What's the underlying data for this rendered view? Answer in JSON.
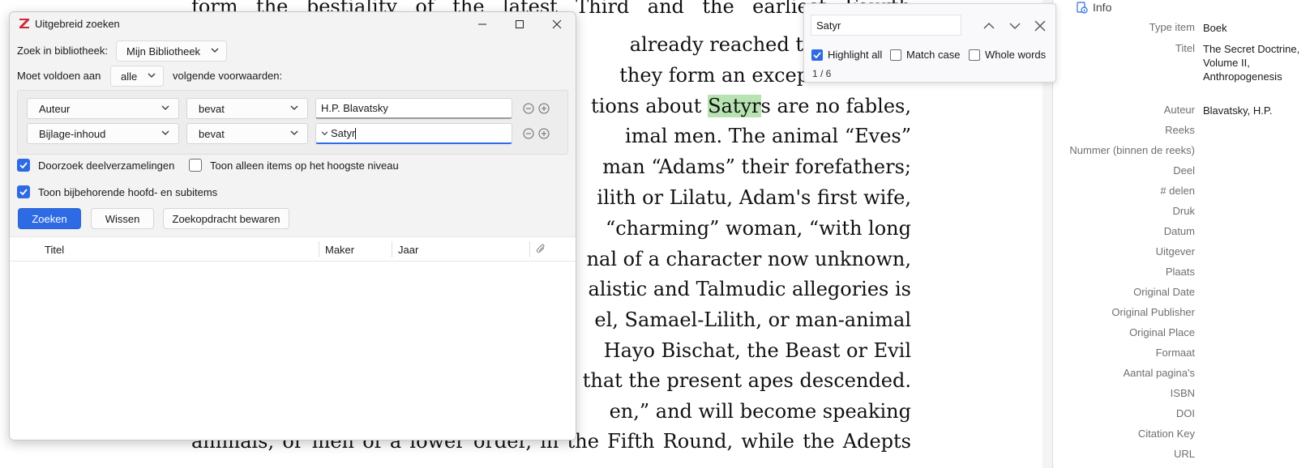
{
  "document": {
    "lines": [
      "form the bestiality of the latest Third and the earliest Fourth",
      "already reached the “human",
      "they form an exception to the",
      "tions about",
      "are no fables,",
      "imal men.  The animal “Eves”",
      "man “Adams” their forefathers;",
      "ilith or Lilatu, Adam's first wife,",
      "“charming” woman, “with long",
      "nal of a character now unknown,",
      "alistic and Talmudic allegories is",
      "el, Samael-Lilith, or man-animal",
      "Hayo Bischat, the Beast or Evil",
      "n that the present apes descended.",
      "en,” and will become speaking",
      "animals, or men of a lower order, in the Fifth Round, while the Adepts"
    ],
    "highlight": "Satyr",
    "highlight_suffix": "s"
  },
  "find_bar": {
    "query": "Satyr",
    "options": [
      {
        "label": "Highlight all",
        "checked": true
      },
      {
        "label": "Match case",
        "checked": false
      },
      {
        "label": "Whole words",
        "checked": false
      }
    ],
    "count": "1 / 6"
  },
  "info_pane": {
    "title": "Info",
    "rows": [
      {
        "label": "Type item",
        "value": "Boek"
      },
      {
        "label": "Titel",
        "value": "The Secret Doctrine, Volume II, Anthropogenesis"
      },
      {
        "label": "Auteur",
        "value": "Blavatsky, H.P."
      },
      {
        "label": "Reeks",
        "value": ""
      },
      {
        "label": "Nummer (binnen de reeks)",
        "value": ""
      },
      {
        "label": "Deel",
        "value": ""
      },
      {
        "label": "# delen",
        "value": ""
      },
      {
        "label": "Druk",
        "value": ""
      },
      {
        "label": "Datum",
        "value": ""
      },
      {
        "label": "Uitgever",
        "value": ""
      },
      {
        "label": "Plaats",
        "value": ""
      },
      {
        "label": "Original Date",
        "value": ""
      },
      {
        "label": "Original Publisher",
        "value": ""
      },
      {
        "label": "Original Place",
        "value": ""
      },
      {
        "label": "Formaat",
        "value": ""
      },
      {
        "label": "Aantal pagina's",
        "value": ""
      },
      {
        "label": "ISBN",
        "value": ""
      },
      {
        "label": "DOI",
        "value": ""
      },
      {
        "label": "Citation Key",
        "value": ""
      },
      {
        "label": "URL",
        "value": ""
      }
    ]
  },
  "advanced_search": {
    "title": "Uitgebreid zoeken",
    "library_label": "Zoek in bibliotheek:",
    "library_value": "Mijn Bibliotheek",
    "match_label": "Moet voldoen aan",
    "match_value": "alle",
    "match_suffix": "volgende voorwaarden:",
    "conditions": [
      {
        "field": "Auteur",
        "operator": "bevat",
        "value": "H.P. Blavatsky"
      },
      {
        "field": "Bijlage-inhoud",
        "operator": "bevat",
        "value": "Satyr"
      }
    ],
    "checkboxes": [
      {
        "label": "Doorzoek deelverzamelingen",
        "checked": true
      },
      {
        "label": "Toon alleen items op het hoogste niveau",
        "checked": false
      },
      {
        "label": "Toon bijbehorende hoofd- en subitems",
        "checked": true
      }
    ],
    "buttons": {
      "search": "Zoeken",
      "clear": "Wissen",
      "save": "Zoekopdracht bewaren"
    },
    "columns": [
      "Titel",
      "Maker",
      "Jaar"
    ]
  },
  "colors": {
    "accent": "#2d6ae3",
    "highlight": "#b6e3b1",
    "zotero_red": "#cc2936"
  }
}
